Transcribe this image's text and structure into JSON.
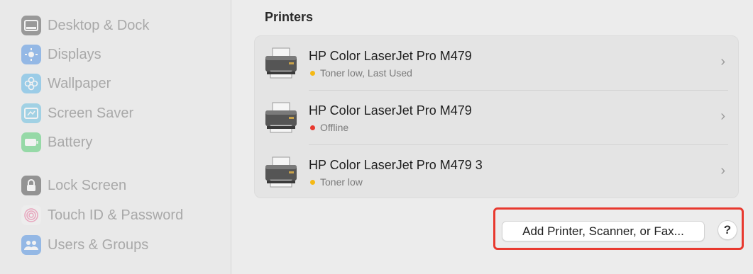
{
  "sidebar": {
    "items": [
      {
        "label": "Desktop & Dock",
        "icon": "desktop-dock-icon",
        "color": "#3a3a3a"
      },
      {
        "label": "Displays",
        "icon": "displays-icon",
        "color": "#2f7de1"
      },
      {
        "label": "Wallpaper",
        "icon": "wallpaper-icon",
        "color": "#3fa9e5"
      },
      {
        "label": "Screen Saver",
        "icon": "screen-saver-icon",
        "color": "#4cb6e0"
      },
      {
        "label": "Battery",
        "icon": "battery-icon",
        "color": "#34c759"
      },
      {
        "label": "Lock Screen",
        "icon": "lock-screen-icon",
        "color": "#2c2c2c"
      },
      {
        "label": "Touch ID & Password",
        "icon": "touch-id-icon",
        "color": "#e8548a"
      },
      {
        "label": "Users & Groups",
        "icon": "users-groups-icon",
        "color": "#2f7de1"
      }
    ]
  },
  "main": {
    "section_title": "Printers",
    "printers": [
      {
        "name": "HP Color LaserJet Pro M479",
        "status": "Toner low, Last Used",
        "status_color": "#f5b915"
      },
      {
        "name": "HP Color LaserJet Pro M479",
        "status": "Offline",
        "status_color": "#e8392f"
      },
      {
        "name": "HP Color LaserJet Pro M479 3",
        "status": "Toner low",
        "status_color": "#f5b915"
      }
    ],
    "add_button_label": "Add Printer, Scanner, or Fax...",
    "help_label": "?",
    "chevron": "›"
  },
  "colors": {
    "highlight": "#e8392f"
  }
}
